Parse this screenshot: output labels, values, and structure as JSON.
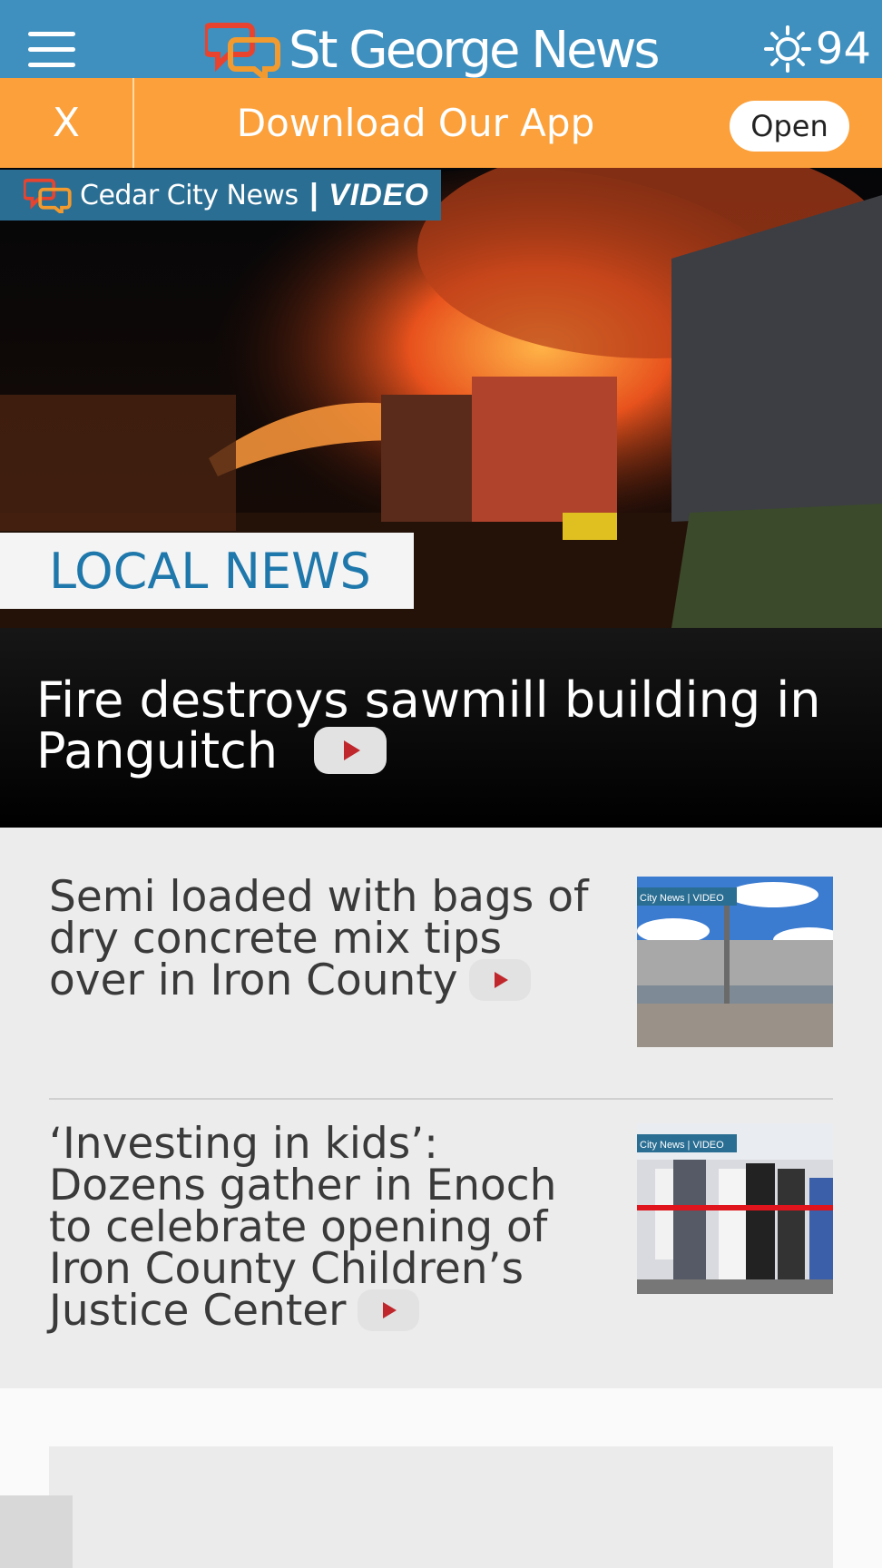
{
  "header": {
    "site_name": "St George News",
    "weather_temp": "94",
    "icons": {
      "menu": "hamburger-icon",
      "logo": "chat-bubbles-icon",
      "weather": "sun-icon"
    },
    "colors": {
      "header_bg": "#3f90bf",
      "banner_bg": "#fba03a"
    }
  },
  "app_banner": {
    "close_label": "X",
    "text": "Download Our App",
    "open_label": "Open"
  },
  "hero": {
    "tag_brand": "Cedar City News",
    "tag_separator": "|",
    "tag_video": "VIDEO",
    "section_label": "LOCAL NEWS",
    "headline": "Fire destroys sawmill building in Panguitch"
  },
  "stories": [
    {
      "title": "Semi loaded with bags of dry concrete mix tips over in Iron County",
      "thumb_tag": "City News | VIDEO"
    },
    {
      "title": "‘Investing in kids’: Dozens gather in Enoch to celebrate opening of Iron County Children’s Justice Center",
      "thumb_tag": "City News | VIDEO"
    }
  ]
}
